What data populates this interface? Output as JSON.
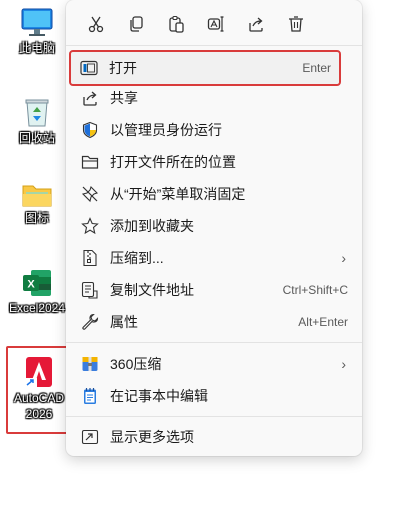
{
  "desktop": {
    "items": [
      {
        "label": "此电脑"
      },
      {
        "label": "回收站"
      },
      {
        "label": "图标"
      },
      {
        "label": "Excel2024"
      },
      {
        "label_line1": "AutoCAD",
        "label_line2": "2026"
      }
    ]
  },
  "menu": {
    "toolbar": [
      "cut-icon",
      "copy-icon",
      "paste-icon",
      "rename-icon",
      "share-icon",
      "delete-icon"
    ],
    "items": [
      {
        "label": "打开",
        "shortcut": "Enter"
      },
      {
        "label": "共享"
      },
      {
        "label": "以管理员身份运行"
      },
      {
        "label": "打开文件所在的位置"
      },
      {
        "label": "从“开始”菜单取消固定"
      },
      {
        "label": "添加到收藏夹"
      },
      {
        "label": "压缩到...",
        "submenu": "›"
      },
      {
        "label": "复制文件地址",
        "shortcut": "Ctrl+Shift+C"
      },
      {
        "label": "属性",
        "shortcut": "Alt+Enter"
      },
      {
        "label": "360压缩",
        "submenu": "›"
      },
      {
        "label": "在记事本中编辑"
      },
      {
        "label": "显示更多选项"
      }
    ]
  },
  "colors": {
    "highlight_border": "#d93b3b",
    "accent": "#0067c0"
  }
}
